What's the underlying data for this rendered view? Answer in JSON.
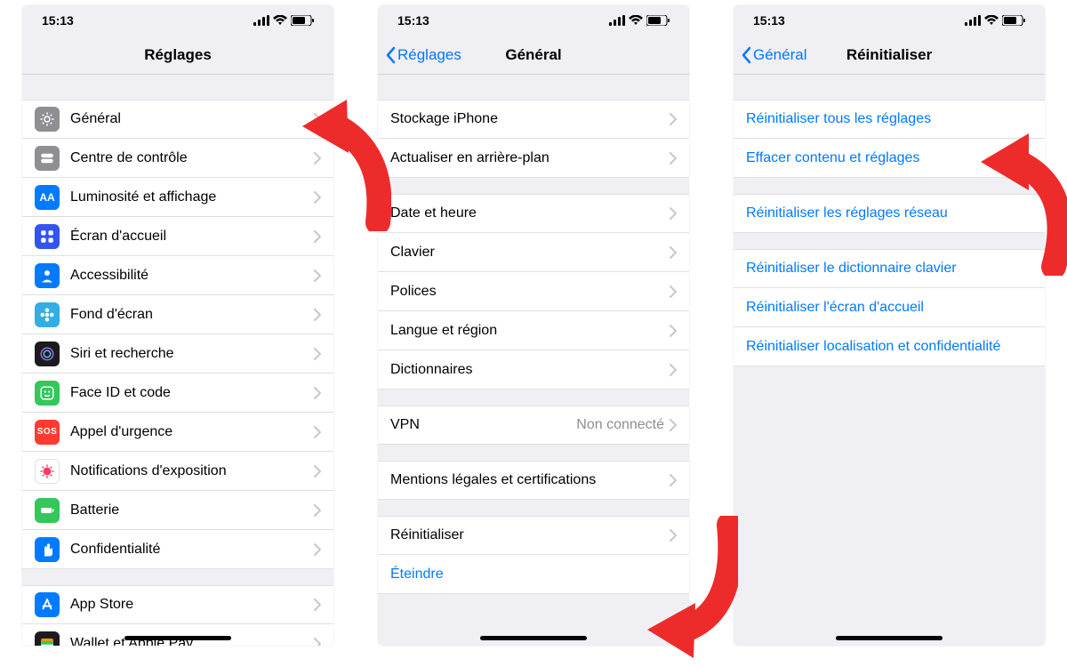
{
  "status": {
    "time": "15:13"
  },
  "screen1": {
    "title": "Réglages",
    "groups": [
      [
        {
          "label": "Général",
          "icon": "gear",
          "bg": "bg-grey"
        },
        {
          "label": "Centre de contrôle",
          "icon": "toggles",
          "bg": "bg-grey"
        },
        {
          "label": "Luminosité et affichage",
          "icon": "aa",
          "bg": "bg-blue"
        },
        {
          "label": "Écran d'accueil",
          "icon": "grid",
          "bg": "bg-indigo"
        },
        {
          "label": "Accessibilité",
          "icon": "person",
          "bg": "bg-blue"
        },
        {
          "label": "Fond d'écran",
          "icon": "flower",
          "bg": "bg-cyan"
        },
        {
          "label": "Siri et recherche",
          "icon": "siri",
          "bg": "bg-black"
        },
        {
          "label": "Face ID et code",
          "icon": "face",
          "bg": "bg-green"
        },
        {
          "label": "Appel d'urgence",
          "icon": "sos",
          "bg": "bg-red"
        },
        {
          "label": "Notifications d'exposition",
          "icon": "virus",
          "bg": "bg-white"
        },
        {
          "label": "Batterie",
          "icon": "battery",
          "bg": "bg-green"
        },
        {
          "label": "Confidentialité",
          "icon": "hand",
          "bg": "bg-blue"
        }
      ],
      [
        {
          "label": "App Store",
          "icon": "appstore",
          "bg": "bg-blue"
        },
        {
          "label": "Wallet et Apple Pay",
          "icon": "wallet",
          "bg": "bg-black"
        }
      ]
    ]
  },
  "screen2": {
    "back": "Réglages",
    "title": "Général",
    "groups": [
      [
        {
          "label": "Stockage iPhone"
        },
        {
          "label": "Actualiser en arrière-plan"
        }
      ],
      [
        {
          "label": "Date et heure"
        },
        {
          "label": "Clavier"
        },
        {
          "label": "Polices"
        },
        {
          "label": "Langue et région"
        },
        {
          "label": "Dictionnaires"
        }
      ],
      [
        {
          "label": "VPN",
          "value": "Non connecté"
        }
      ],
      [
        {
          "label": "Mentions légales et certifications"
        }
      ],
      [
        {
          "label": "Réinitialiser"
        },
        {
          "label": "Éteindre",
          "link": true,
          "noChevron": true
        }
      ]
    ]
  },
  "screen3": {
    "back": "Général",
    "title": "Réinitialiser",
    "groups": [
      [
        {
          "label": "Réinitialiser tous les réglages",
          "link": true
        },
        {
          "label": "Effacer contenu et réglages",
          "link": true
        }
      ],
      [
        {
          "label": "Réinitialiser les réglages réseau",
          "link": true
        }
      ],
      [
        {
          "label": "Réinitialiser le dictionnaire clavier",
          "link": true
        },
        {
          "label": "Réinitialiser l'écran d'accueil",
          "link": true
        },
        {
          "label": "Réinitialiser localisation et confidentialité",
          "link": true
        }
      ]
    ]
  }
}
